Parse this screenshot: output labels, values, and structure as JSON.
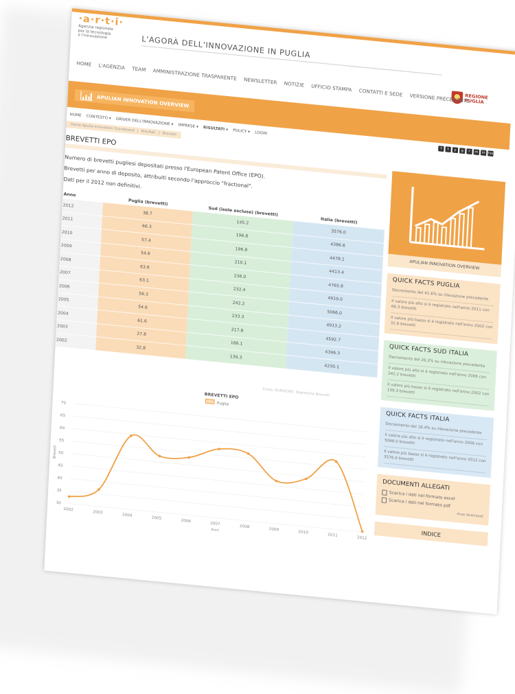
{
  "site": {
    "logo": "·a·r·t·i·",
    "agency_lines": [
      "Agenzia regionale",
      "per la tecnologia",
      "e l'innovazione"
    ],
    "title": "L'AGORÀ DELL'INNOVAZIONE IN PUGLIA",
    "region_lines": [
      "REGIONE",
      "PUGLIA"
    ]
  },
  "topnav": [
    "HOME",
    "L'AGENZIA",
    "TEAM",
    "AMMINISTRAZIONE TRASPARENTE",
    "NEWSLETTER",
    "NOTIZIE",
    "UFFICIO STAMPA",
    "CONTATTI E SEDE",
    "VERSIONE PRECEDENTE"
  ],
  "banner": {
    "label": "APULIAN INNOVATION OVERVIEW"
  },
  "subnav": [
    "HOME",
    "CONTESTO ▾",
    "DRIVER DELL'INNOVAZIONE ▾",
    "IMPRESE ▾",
    "RISULTATI ▾",
    "POLICY ▾",
    "LOGIN"
  ],
  "social": [
    "f",
    "t",
    "y",
    "g",
    "r",
    "m",
    "in",
    "rss"
  ],
  "breadcrumb": [
    "Home Apulia Innovation Scoreboard",
    "Risultati",
    "Brevetti"
  ],
  "page": {
    "title": "BREVETTI EPO",
    "intro": [
      "Numero di brevetti pugliesi depositati presso l'European Patent Office (EPO).",
      "Brevetti per anno di deposito, attribuiti secondo l'approccio \"fractional\".",
      "Dati per il 2012 non definitivi."
    ]
  },
  "table": {
    "headers": [
      "Anno",
      "Puglia (brevetti)",
      "Sud (isole escluse) (brevetti)",
      "Italia (brevetti)"
    ],
    "rows": [
      [
        "2012",
        "38.7",
        "145.2",
        "3576.0"
      ],
      [
        "2011",
        "66.3",
        "196.8",
        "4386.6"
      ],
      [
        "2010",
        "57.4",
        "196.8",
        "4478.1"
      ],
      [
        "2009",
        "54.6",
        "210.1",
        "4413.4"
      ],
      [
        "2008",
        "63.6",
        "236.0",
        "4765.8"
      ],
      [
        "2007",
        "63.1",
        "232.4",
        "4919.0"
      ],
      [
        "2006",
        "56.3",
        "242.2",
        "5066.0"
      ],
      [
        "2005",
        "54.6",
        "233.3",
        "4913.2"
      ],
      [
        "2004",
        "61.6",
        "217.8",
        "4592.7"
      ],
      [
        "2003",
        "27.8",
        "166.1",
        "4396.3"
      ],
      [
        "2002",
        "32.8",
        "139.3",
        "4230.1"
      ]
    ],
    "source": "Fonte: EUROSTAT, Statistiche Brevetti"
  },
  "chart_data": {
    "type": "line",
    "title": "BREVETTI EPO",
    "xlabel": "Anni",
    "ylabel": "Brevetti",
    "x": [
      "2002",
      "2003",
      "2004",
      "2005",
      "2006",
      "2007",
      "2008",
      "2009",
      "2010",
      "2011",
      "2012"
    ],
    "series": [
      {
        "name": "Puglia",
        "values": [
          32.8,
          36.8,
          59.4,
          52.4,
          53.0,
          57.5,
          56.8,
          47.0,
          49.0,
          57.0,
          30.2
        ]
      }
    ],
    "ylim": [
      30,
      70
    ],
    "yticks": [
      30,
      35,
      40,
      45,
      50,
      55,
      60,
      65,
      70
    ],
    "grid": true,
    "legend": "top-center",
    "color": "#f0a247"
  },
  "sidebar": {
    "hero_label": "APULIAN INNOVATION OVERVIEW",
    "puglia": {
      "title": "QUICK FACTS PUGLIA",
      "lines": [
        "Decremento del 41.6% su rilevazione precedente",
        "Il valore più alto si è registrato nell'anno 2011 con 66.3 brevetti",
        "Il valore più basso si è registrato nell'anno 2002 con 32.8 brevetti"
      ]
    },
    "sud": {
      "title": "QUICK FACTS SUD ITALIA",
      "lines": [
        "Decremento del 26.2% su rilevazione precedente",
        "Il valore più alto si è registrato nell'anno 2006 con 242.2 brevetti",
        "Il valore più basso si è registrato nell'anno 2002 con 139.3 brevetti"
      ]
    },
    "italia": {
      "title": "QUICK FACTS ITALIA",
      "lines": [
        "Decremento del 18.4% su rilevazione precedente",
        "Il valore più alto si è registrato nell'anno 2006 con 5066.0 brevetti",
        "Il valore più basso si è registrato nell'anno 2012 con 3576.0 brevetti"
      ]
    },
    "docs": {
      "title": "DOCUMENTI ALLEGATI",
      "excel": "Scarica i dati nel formato excel",
      "pdf": "Scarica i dati nel formato pdf",
      "more": "Area download"
    },
    "indice": "INDICE"
  },
  "colors": {
    "accent": "#f0a247",
    "puglia": "#fbdcb8",
    "sud": "#d8eed9",
    "italia": "#d5e6f3"
  }
}
